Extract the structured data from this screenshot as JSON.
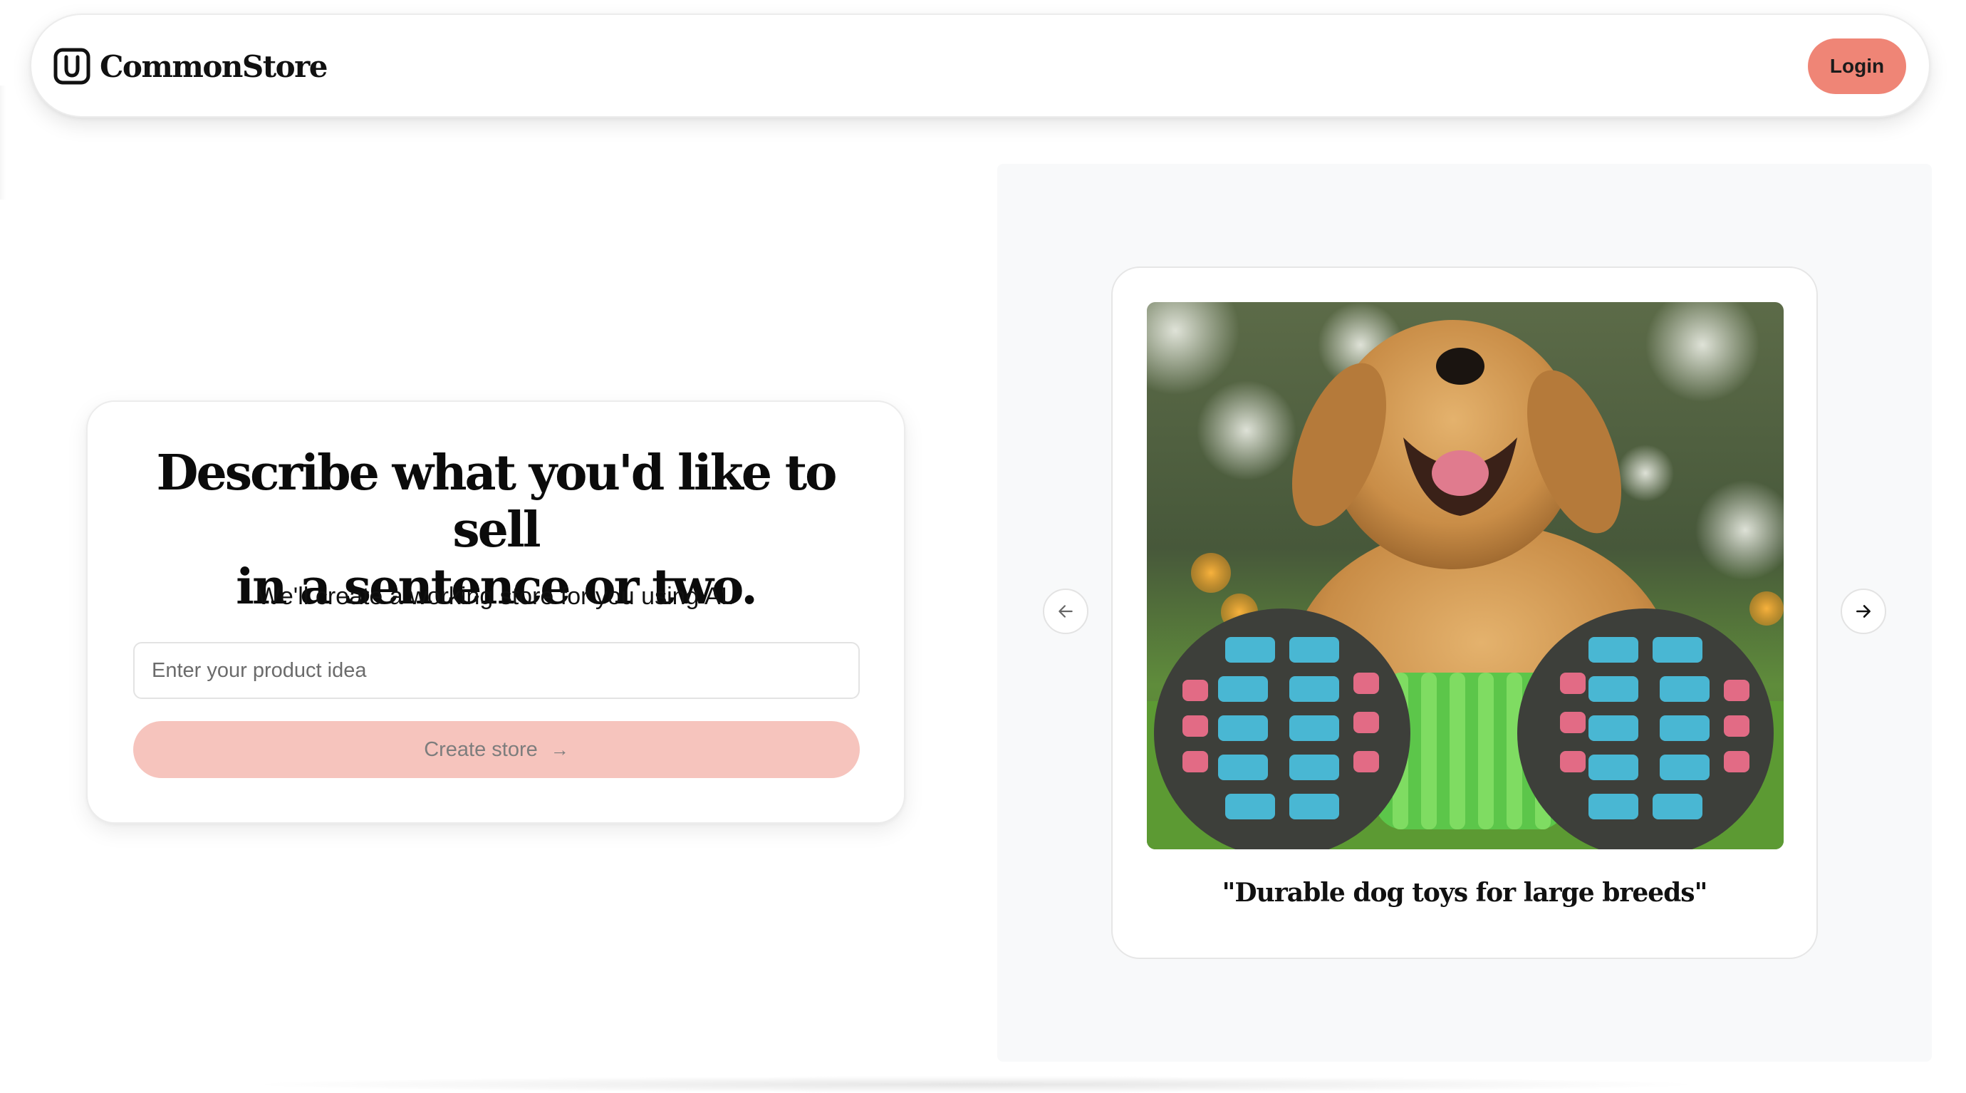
{
  "header": {
    "brand": "CommonStore",
    "login_label": "Login"
  },
  "form": {
    "headline_line1": "Describe what you'd like to sell",
    "headline_line2": "in a sentence or two.",
    "subheading": "We'll create a working store for you using AI.",
    "input_placeholder": "Enter your product idea",
    "input_value": "",
    "create_label": "Create store"
  },
  "carousel": {
    "caption": "\"Durable dog toys for large breeds\"",
    "image_subject": "golden retriever with green and blue rubber chew toy on grass",
    "prev_icon": "arrow-left-icon",
    "next_icon": "arrow-right-icon"
  },
  "colors": {
    "brand_accent": "#ef8576",
    "create_disabled": "#f6c4bd",
    "panel_bg": "#f8f9fa"
  }
}
